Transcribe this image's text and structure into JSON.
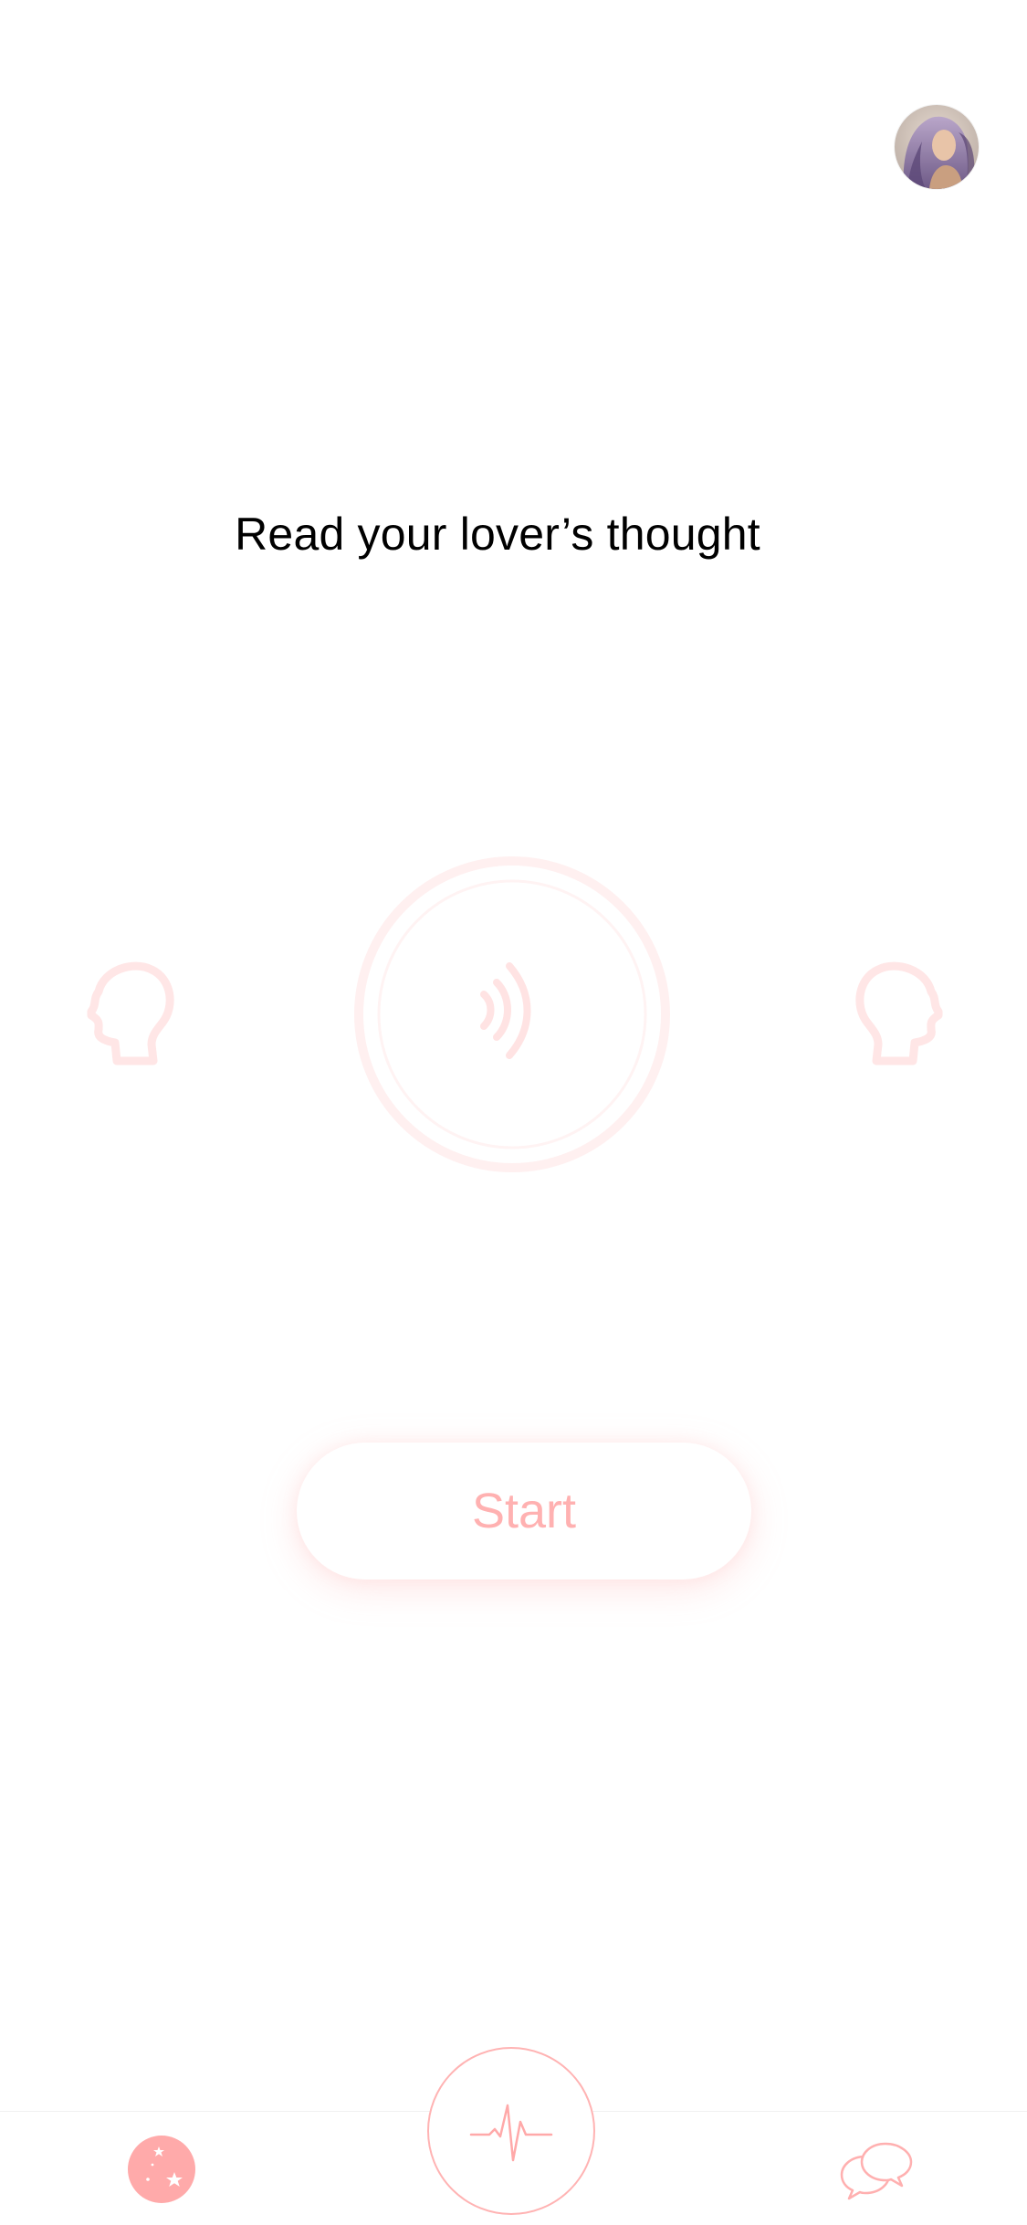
{
  "title": "Read your lover’s thought",
  "start_button": {
    "label": "Start"
  },
  "icons": {
    "avatar": "profile-avatar",
    "left_head": "head-profile-left-icon",
    "right_head": "head-profile-right-icon",
    "signal": "sound-wave-icon",
    "tab_stars": "stars-icon",
    "tab_center": "heartbeat-icon",
    "tab_chat": "chat-bubbles-icon"
  },
  "colors": {
    "accent": "#ffaaaa",
    "faint_accent": "#ffeaea",
    "text": "#000000"
  }
}
